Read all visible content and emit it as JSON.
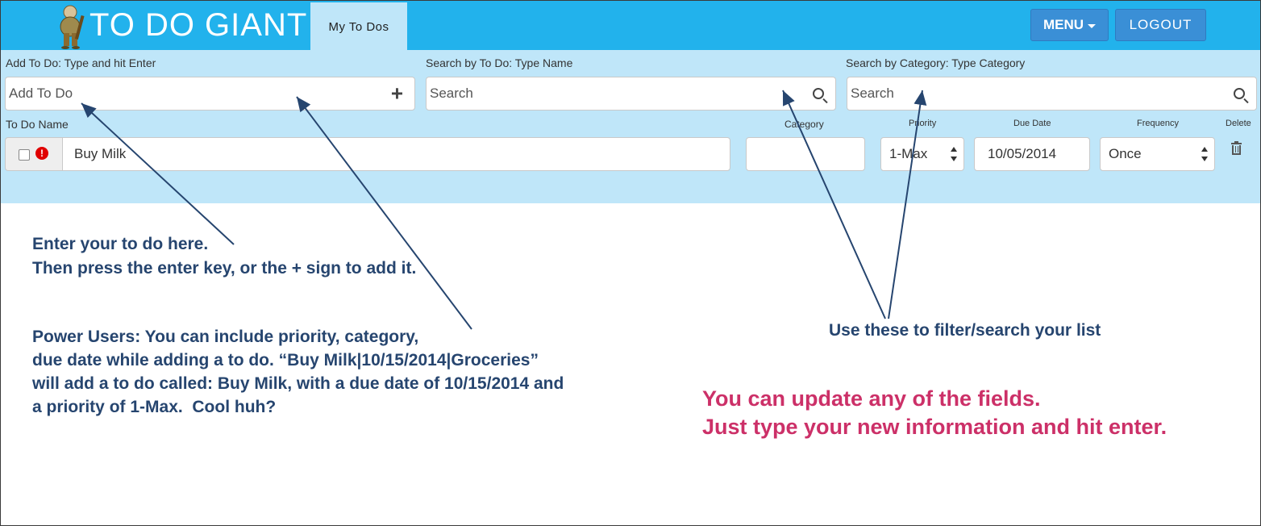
{
  "header": {
    "brand": "TO DO GIANT",
    "active_tab": "My To Dos",
    "menu_label": "MENU",
    "logout_label": "LOGOUT"
  },
  "toolbar": {
    "add": {
      "label": "Add To Do: Type and hit Enter",
      "placeholder": "Add To Do",
      "button_icon": "plus-icon"
    },
    "search_name": {
      "label": "Search by To Do: Type Name",
      "placeholder": "Search",
      "button_icon": "search-icon"
    },
    "search_category": {
      "label": "Search by Category: Type Category",
      "placeholder": "Search",
      "button_icon": "search-icon"
    }
  },
  "columns": {
    "name": "To Do Name",
    "category": "Category",
    "priority": "Priority",
    "due_date": "Due Date",
    "frequency": "Frequency",
    "delete": "Delete"
  },
  "todos": [
    {
      "name": "Buy Milk",
      "category": "",
      "priority": "1-Max",
      "due_date": "10/05/2014",
      "frequency": "Once",
      "checked": false,
      "alert_icon": "!"
    }
  ],
  "annotations": {
    "enter_line1": "Enter your to do here.",
    "enter_line2": "Then press the enter key, or the + sign to add it.",
    "power_line1": "Power Users: You can include priority, category,",
    "power_line2": "due date while adding a to do. “Buy Milk|10/15/2014|Groceries”",
    "power_line3": "will add a to do called: Buy Milk, with a due date of 10/15/2014 and",
    "power_line4": "a priority of 1-Max.  Cool huh?",
    "filter": "Use these to filter/search your list",
    "update_line1": "You can update any of the fields.",
    "update_line2": "Just type your new information and hit enter."
  },
  "colors": {
    "header": "#22b2ec",
    "panel": "#bfe6f9",
    "button": "#3a8fd6",
    "annotation": "#26456f",
    "highlight": "#cc3068",
    "alert": "#e00000"
  }
}
